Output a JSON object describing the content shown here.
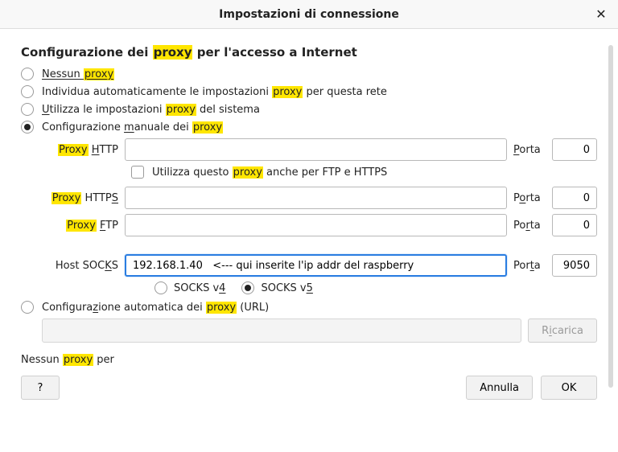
{
  "dialog": {
    "title": "Impostazioni di connessione"
  },
  "section_title_pre": "Configurazione dei ",
  "section_title_hl": "proxy",
  "section_title_post": " per l'accesso a Internet",
  "options": {
    "no_proxy_pre": "Nessun ",
    "no_proxy_hl": "proxy",
    "auto_detect_pre": "Individua automaticamente le impostazioni ",
    "auto_detect_hl": "proxy",
    "auto_detect_post": " per questa rete",
    "system_pre": "Utilizza le impostazioni ",
    "system_hl": "proxy",
    "system_post": " del sistema",
    "manual_pre": "Configurazione manuale dei ",
    "manual_hl": "proxy",
    "auto_url_pre": "Configurazione automatica dei ",
    "auto_url_hl": "proxy",
    "auto_url_post": " (URL)"
  },
  "fields": {
    "http_label_hl": "Proxy",
    "http_label_post": " HTTP",
    "https_label_hl": "Proxy",
    "https_label_post": " HTTPS",
    "ftp_label_hl": "Proxy",
    "ftp_label_post": " FTP",
    "socks_label": "Host SOCKS",
    "port_label": "Porta",
    "use_for_all_pre": "Utilizza questo ",
    "use_for_all_hl": "proxy",
    "use_for_all_post": " anche per FTP e HTTPS",
    "socks_v4": "SOCKS v4",
    "socks_v5": "SOCKS v5"
  },
  "values": {
    "http_host": "",
    "http_port": "0",
    "https_host": "",
    "https_port": "0",
    "ftp_host": "",
    "ftp_port": "0",
    "socks_host": "192.168.1.40   <--- qui inserite l'ip addr del raspberry",
    "socks_port": "9050"
  },
  "buttons": {
    "reload": "Ricarica",
    "help": "?",
    "cancel": "Annulla",
    "ok": "OK"
  },
  "no_proxy_for_pre": "Nessun ",
  "no_proxy_for_hl": "proxy",
  "no_proxy_for_post": " per"
}
